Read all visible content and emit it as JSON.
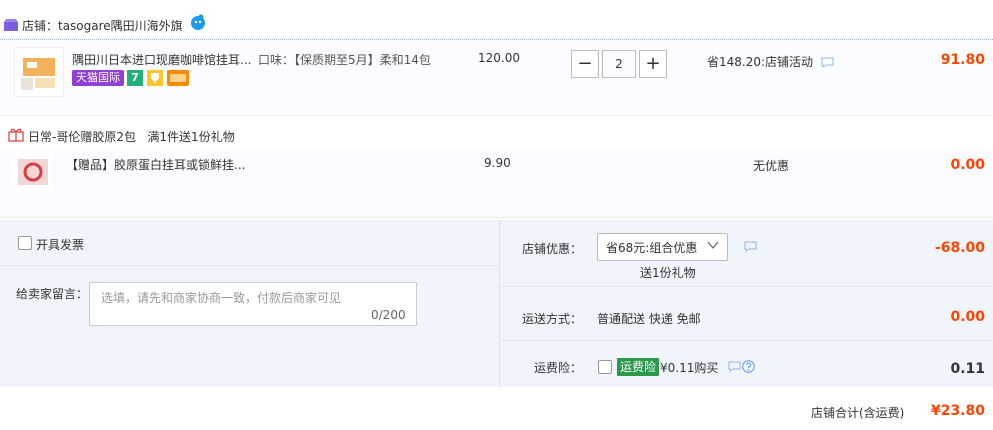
{
  "shop": {
    "label": "店铺：tasogare隅田川海外旗",
    "icon": "shop-icon",
    "chat_icon": "wangwang-chat-icon"
  },
  "item": {
    "title": "隅田川日本进口现磨咖啡馆挂耳...",
    "sku": "口味：【保质期至5月】柔和14包",
    "tag": "天猫国际",
    "badge_seven": "7",
    "price": "120.00",
    "quantity": "2",
    "minus": "−",
    "plus": "+",
    "promo": "省148.20:店铺活动",
    "total": "91.80"
  },
  "gift": {
    "header": "日常-哥伦赠胶原2包",
    "rule": "满1件送1份礼物",
    "title": "【赠品】胶原蛋白挂耳或锁鲜挂...",
    "price": "9.90",
    "promo": "无优惠",
    "total": "0.00"
  },
  "invoice": {
    "label": "开具发票"
  },
  "message": {
    "label": "给卖家留言：",
    "placeholder": "选填，请先和商家协商一致，付款后商家可见",
    "count": "0/200"
  },
  "discount": {
    "label": "店铺优惠：",
    "selected": "省68元:组合优惠",
    "sub": "送1份礼物",
    "total": "-68.00"
  },
  "shipping": {
    "label": "运送方式：",
    "value": "普通配送 快递 免邮",
    "total": "0.00"
  },
  "insurance": {
    "label": "运费险：",
    "badge": "运费险",
    "price": "¥0.11购买",
    "total": "0.11"
  },
  "footer": {
    "label": "店铺合计(含运费)",
    "total": "¥23.80"
  },
  "colors": {
    "accent": "#ff4400",
    "tmall_purple": "#8f3fd1",
    "insurance_green": "#2a9a4a",
    "panel_bg": "#f0f4fb"
  }
}
